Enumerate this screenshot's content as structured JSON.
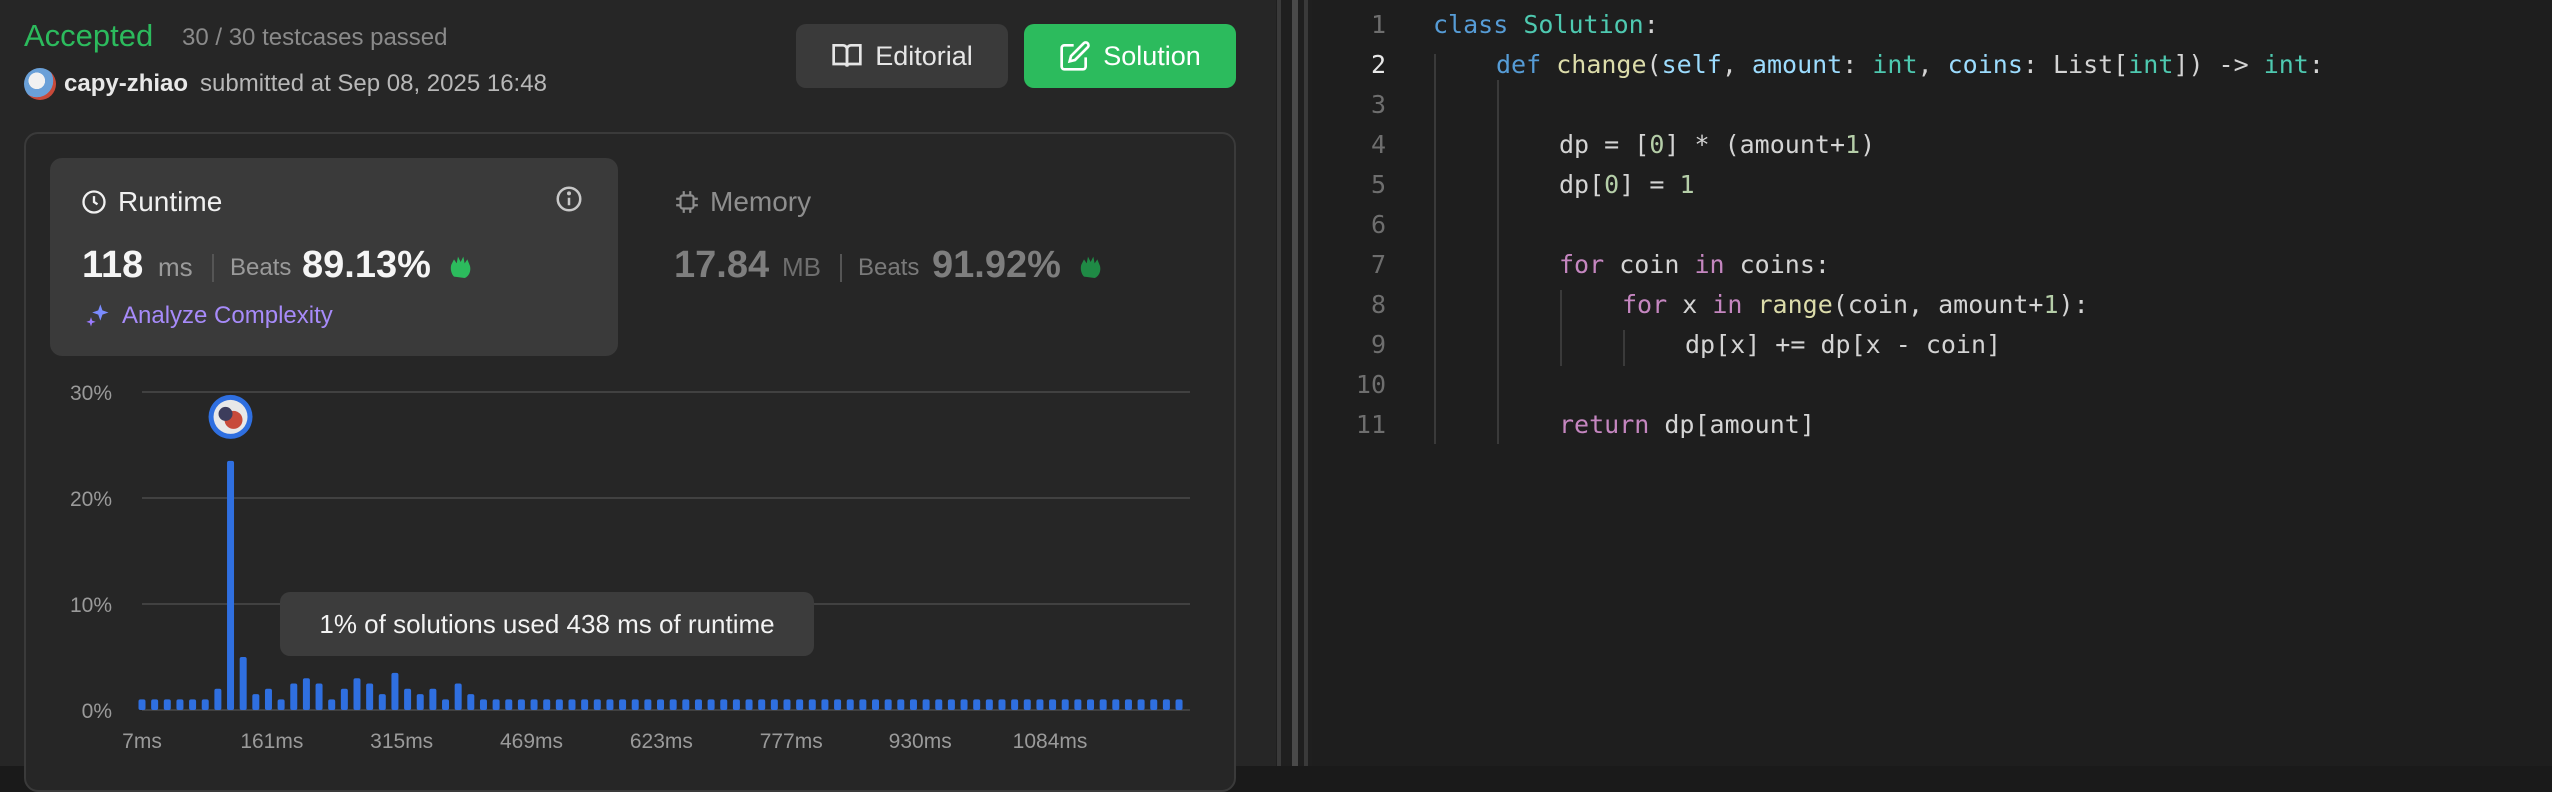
{
  "submission": {
    "status": "Accepted",
    "tests": "30 / 30 testcases passed",
    "user": "capy-zhiao",
    "submitted": "submitted at Sep 08, 2025 16:48"
  },
  "buttons": {
    "editorial": "Editorial",
    "solution": "Solution"
  },
  "runtime": {
    "title": "Runtime",
    "value": "118",
    "unit": "ms",
    "beats_label": "Beats",
    "beats": "89.13%",
    "analyze": "Analyze Complexity"
  },
  "memory": {
    "title": "Memory",
    "value": "17.84",
    "unit": "MB",
    "beats_label": "Beats",
    "beats": "91.92%"
  },
  "tooltip": "1% of solutions used 438 ms of runtime",
  "colors": {
    "accepted": "#2cbb5d",
    "bar": "#2f6fe0",
    "accent_purple": "#a78bfa"
  },
  "chart_data": {
    "type": "bar",
    "title": "",
    "xlabel": "",
    "ylabel": "",
    "y_ticks": [
      "0%",
      "10%",
      "20%",
      "30%"
    ],
    "ylim": [
      0,
      30
    ],
    "x_ticks": [
      "7ms",
      "161ms",
      "315ms",
      "469ms",
      "623ms",
      "777ms",
      "930ms",
      "1084ms"
    ],
    "x_tick_values": [
      7,
      161,
      315,
      469,
      623,
      777,
      930,
      1084
    ],
    "bins_ms": [
      7,
      22,
      37,
      52,
      67,
      82,
      97,
      112,
      127,
      142,
      157,
      172,
      187,
      202,
      217,
      232,
      247,
      262,
      277,
      292,
      307,
      322,
      337,
      352,
      367,
      382,
      397,
      412,
      427,
      442,
      457,
      472,
      487,
      502,
      517,
      532,
      547,
      562,
      577,
      592,
      607,
      622,
      637,
      652,
      667,
      682,
      697,
      712,
      727,
      742,
      757,
      772,
      787,
      802,
      817,
      832,
      847,
      862,
      877,
      892,
      907,
      922,
      937,
      952,
      967,
      982,
      997,
      1012,
      1027,
      1042,
      1057,
      1072,
      1087,
      1102,
      1117,
      1132,
      1147,
      1162,
      1177,
      1192,
      1207,
      1222,
      1237
    ],
    "values": [
      1,
      1,
      1,
      1,
      1,
      1,
      2,
      23.5,
      5,
      1.5,
      2,
      1,
      2.5,
      3,
      2.5,
      1,
      2,
      3,
      2.5,
      1.5,
      3.5,
      2,
      1.5,
      2,
      1,
      2.5,
      1.5,
      1,
      1,
      1,
      1,
      1,
      1,
      1,
      1,
      1,
      1,
      1,
      1,
      1,
      1,
      1,
      1,
      1,
      1,
      1,
      1,
      1,
      1,
      1,
      1,
      1,
      1,
      1,
      1,
      1,
      1,
      1,
      1,
      1,
      1,
      1,
      1,
      1,
      1,
      1,
      1,
      1,
      1,
      1,
      1,
      1,
      1,
      1,
      1,
      1,
      1,
      1,
      1,
      1,
      1,
      1,
      1
    ],
    "highlight_bin_ms": 112,
    "grid": true
  },
  "code": {
    "line_numbers": [
      "1",
      "2",
      "3",
      "4",
      "5",
      "6",
      "7",
      "8",
      "9",
      "10",
      "11"
    ],
    "active_line": "2"
  }
}
